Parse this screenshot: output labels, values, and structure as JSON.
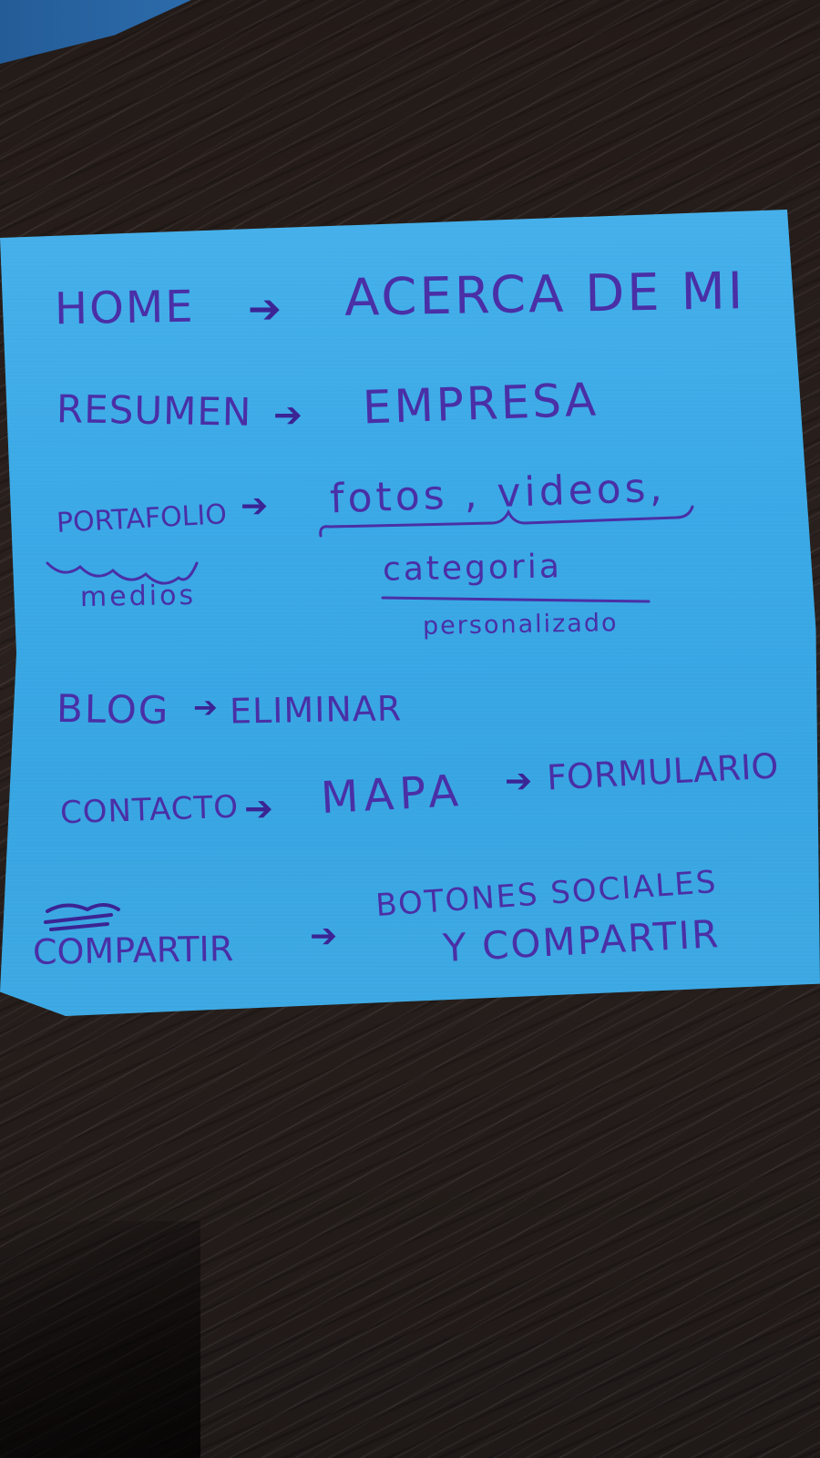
{
  "note": {
    "color": "#3aa9e6",
    "ink_color": "#4a2fa6",
    "rows": [
      {
        "left": "HOME",
        "arrow": "arrow-right-icon",
        "right": "ACERCA DE MI"
      },
      {
        "left": "RESUMEN",
        "arrow": "arrow-right-icon",
        "right": "EMPRESA"
      },
      {
        "left": "PORTAFOLIO",
        "left_sub": "medios",
        "arrow": "arrow-right-icon",
        "right": "fotos , videos,",
        "right_sub": "categoria",
        "right_sub2": "personalizado"
      },
      {
        "left": "BLOG",
        "arrow": "arrow-right-icon",
        "right": "ELIMINAR"
      },
      {
        "left": "CONTACTO",
        "arrow": "arrow-right-icon",
        "right": "MAPA",
        "arrow2": "arrow-right-icon",
        "right2": "FORMULARIO"
      },
      {
        "left": "COMPARTIR",
        "arrow": "arrow-right-icon",
        "right": "BOTONES SOCIALES",
        "right_sub": "Y COMPARTIR"
      }
    ]
  }
}
